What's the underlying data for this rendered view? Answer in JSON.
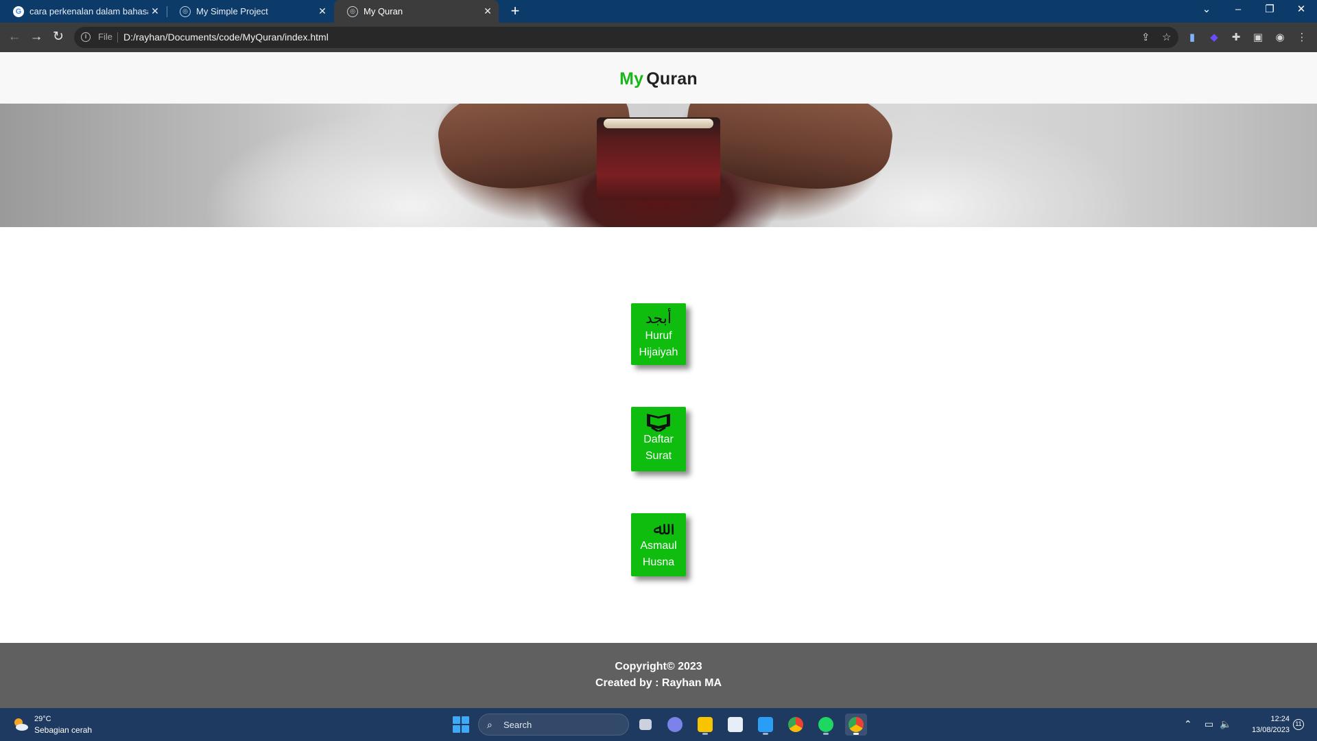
{
  "browser": {
    "tabs": [
      {
        "title": "cara perkenalan dalam bahasa in",
        "favicon": "google-icon"
      },
      {
        "title": "My Simple Project",
        "favicon": "globe-icon"
      },
      {
        "title": "My Quran",
        "favicon": "globe-icon",
        "active": true
      }
    ],
    "address_bar": {
      "scheme_label": "File",
      "url": "D:/rayhan/Documents/code/MyQuran/index.html"
    }
  },
  "page": {
    "brand": {
      "part1": "My",
      "part2": "Quran"
    },
    "hero_image": "person-holding-quran",
    "menu": [
      {
        "icon_text": "أبجد",
        "icon": "arabic-letters-icon",
        "line1": "Huruf",
        "line2": "Hijaiyah"
      },
      {
        "icon": "quran-book-icon",
        "line1": "Daftar",
        "line2": "Surat"
      },
      {
        "icon_text": "ﷲ",
        "icon": "allah-calligraphy-icon",
        "line1": "Asmaul",
        "line2": "Husna"
      }
    ],
    "footer": {
      "copyright": "Copyright© 2023",
      "credit": "Created by : Rayhan MA"
    }
  },
  "taskbar": {
    "weather": {
      "temp": "29°C",
      "desc": "Sebagian cerah"
    },
    "search_placeholder": "Search",
    "clock": {
      "time": "12:24",
      "date": "13/08/2023"
    },
    "notification_count": "11"
  },
  "colors": {
    "brand_green": "#19b71a",
    "card_green": "#0ebd0e",
    "footer_gray": "#606060",
    "tabbar_blue": "#0c3b69",
    "taskbar_blue": "#1f3a61"
  }
}
